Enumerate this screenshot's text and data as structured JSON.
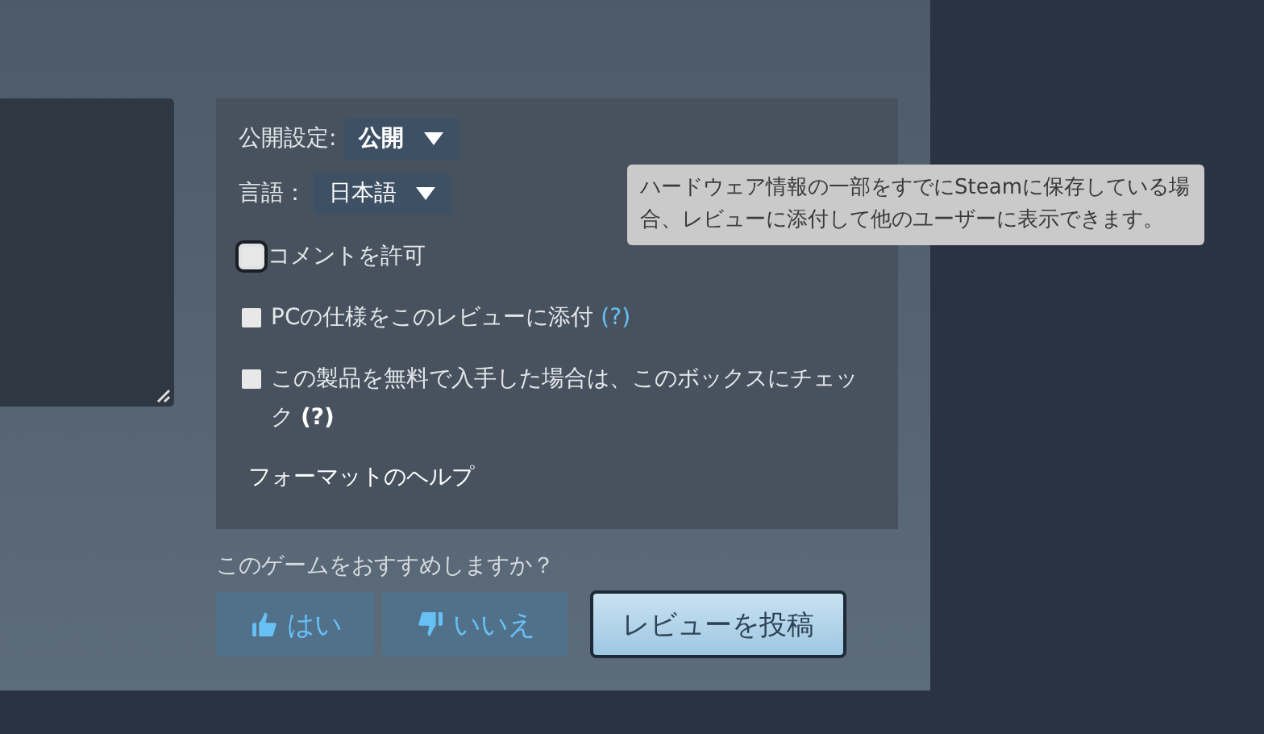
{
  "options": {
    "visibility": {
      "label": "公開設定:",
      "value": "公開"
    },
    "language": {
      "label": "言語：",
      "value": "日本語"
    },
    "checkboxes": [
      {
        "label": "コメントを許可",
        "checked": false,
        "focused": true
      },
      {
        "label": "PCの仕様をこのレビューに添付",
        "checked": false,
        "focused": false,
        "help": {
          "text": "(?)",
          "kind": "link"
        }
      },
      {
        "label": "この製品を無料で入手した場合は、このボックスにチェック",
        "checked": false,
        "focused": false,
        "help": {
          "text": "(?)",
          "kind": "bold"
        }
      }
    ],
    "format_help": "フォーマットのヘルプ"
  },
  "recommend": {
    "question": "このゲームをおすすめしますか？",
    "buttons": [
      {
        "label": "はい",
        "kind": "up"
      },
      {
        "label": "いいえ",
        "kind": "down"
      }
    ]
  },
  "submit": "レビューを投稿",
  "tooltip": {
    "text": "ハードウェア情報の一部をすでにSteamに保存している場合、レビューに添付して他のユーザーに表示できます。"
  }
}
